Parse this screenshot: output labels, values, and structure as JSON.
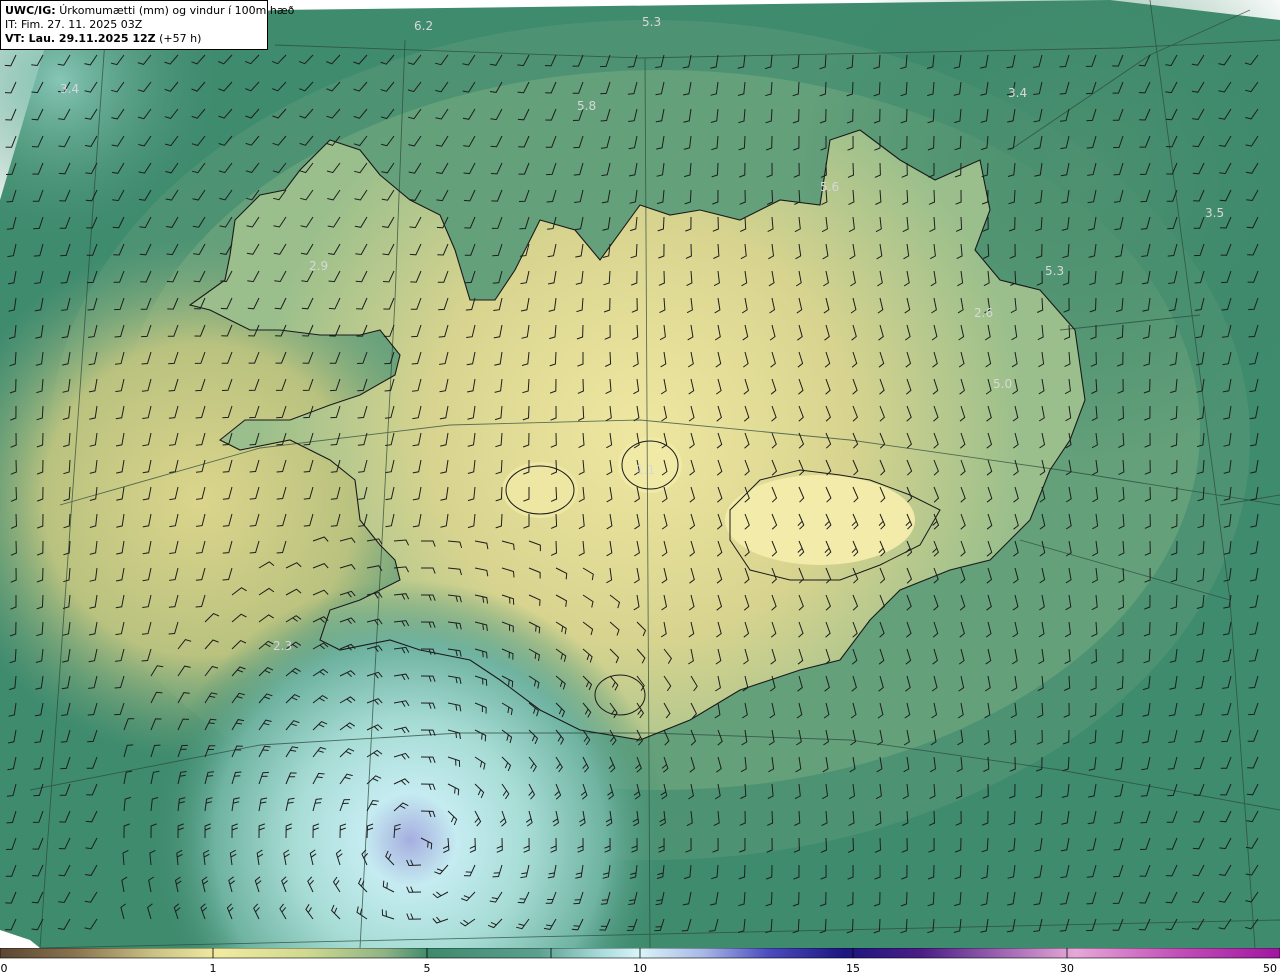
{
  "header": {
    "product_code": "UWC/IG:",
    "product_title": "Úrkomumætti (mm) og vindur í 100m hæð",
    "init_time": "IT: Fim. 27. 11. 2025 03Z",
    "valid_prefix": "VT: Lau. 29.11.2025 12Z",
    "valid_lead": "(+57 h)"
  },
  "map_values": [
    {
      "id": "v1",
      "text": "6.2"
    },
    {
      "id": "v2",
      "text": "5.3"
    },
    {
      "id": "v3",
      "text": "5.8"
    },
    {
      "id": "v4",
      "text": "3.4"
    },
    {
      "id": "v5",
      "text": "5.6"
    },
    {
      "id": "v6",
      "text": "3.5"
    },
    {
      "id": "v7",
      "text": "2.9"
    },
    {
      "id": "v8",
      "text": "5.3"
    },
    {
      "id": "v9",
      "text": "2.6"
    },
    {
      "id": "v10",
      "text": "5.0"
    },
    {
      "id": "v11",
      "text": "1.1"
    },
    {
      "id": "v12",
      "text": "2.3"
    },
    {
      "id": "v13",
      "text": "3.4"
    }
  ],
  "colorbar": {
    "ticks": [
      "0",
      "1",
      "5",
      "10",
      "15",
      "30",
      "50"
    ],
    "colors": [
      "#5a4632",
      "#8a7550",
      "#c9c285",
      "#f1eba0",
      "#cfd98f",
      "#8fb486",
      "#3e8a6d",
      "#5aa08f",
      "#a9dcdc",
      "#d9f5f8",
      "#a6b7e6",
      "#4c4cbf",
      "#1c1580",
      "#4b1e86",
      "#9a62b0",
      "#e6a8d8",
      "#c24fb8",
      "#a016a0"
    ]
  },
  "colors": {
    "sea_deep": "#3e8a6d",
    "land_high": "#eae39b",
    "land_mid": "#c9c888",
    "shelf": "#6aa184",
    "cyan_core": "#c8f0ef",
    "blue_core": "#9fa9d8"
  }
}
